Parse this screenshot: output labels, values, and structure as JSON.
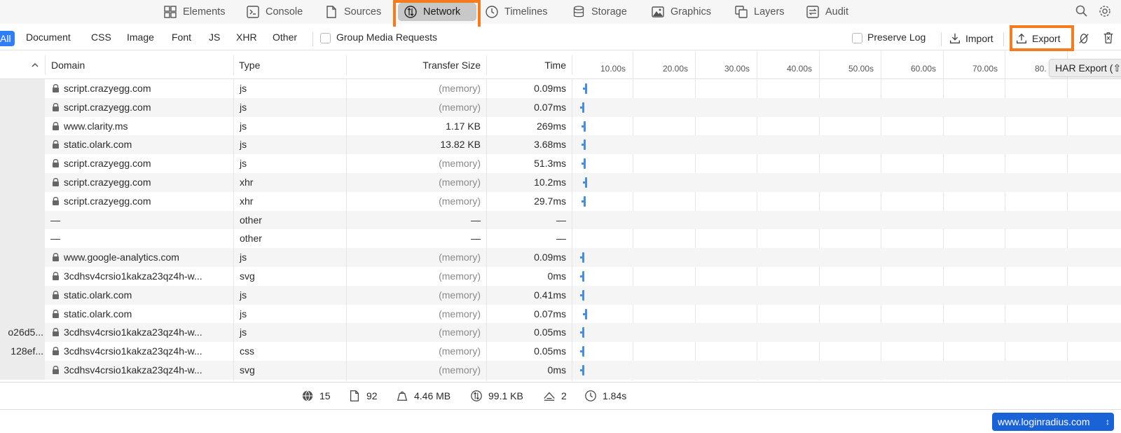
{
  "tabs": [
    {
      "label": "Elements",
      "icon": "elements-icon"
    },
    {
      "label": "Console",
      "icon": "console-icon"
    },
    {
      "label": "Sources",
      "icon": "sources-icon"
    },
    {
      "label": "Network",
      "icon": "network-icon",
      "active": true
    },
    {
      "label": "Timelines",
      "icon": "timelines-icon"
    },
    {
      "label": "Storage",
      "icon": "storage-icon"
    },
    {
      "label": "Graphics",
      "icon": "graphics-icon"
    },
    {
      "label": "Layers",
      "icon": "layers-icon"
    },
    {
      "label": "Audit",
      "icon": "audit-icon"
    }
  ],
  "filters": {
    "all": "All",
    "types": [
      "Document",
      "CSS",
      "Image",
      "Font",
      "JS",
      "XHR",
      "Other"
    ],
    "group_media": "Group Media Requests",
    "preserve_log": "Preserve Log",
    "import": "Import",
    "export": "Export",
    "tooltip": "HAR Export (⇧⌘E)"
  },
  "columns": {
    "domain": "Domain",
    "type": "Type",
    "transfer_size": "Transfer Size",
    "time": "Time"
  },
  "timeline_ticks": [
    "10.00s",
    "20.00s",
    "30.00s",
    "40.00s",
    "50.00s",
    "60.00s",
    "70.00s",
    "80."
  ],
  "rows": [
    {
      "name": "",
      "secure": true,
      "domain": "script.crazyegg.com",
      "type": "js",
      "size": "(memory)",
      "time": "0.09ms"
    },
    {
      "name": "",
      "secure": true,
      "domain": "script.crazyegg.com",
      "type": "js",
      "size": "(memory)",
      "time": "0.07ms"
    },
    {
      "name": "",
      "secure": true,
      "domain": "www.clarity.ms",
      "type": "js",
      "size": "1.17 KB",
      "time": "269ms"
    },
    {
      "name": "",
      "secure": true,
      "domain": "static.olark.com",
      "type": "js",
      "size": "13.82 KB",
      "time": "3.68ms"
    },
    {
      "name": "",
      "secure": true,
      "domain": "script.crazyegg.com",
      "type": "js",
      "size": "(memory)",
      "time": "51.3ms"
    },
    {
      "name": "",
      "secure": true,
      "domain": "script.crazyegg.com",
      "type": "xhr",
      "size": "(memory)",
      "time": "10.2ms"
    },
    {
      "name": "",
      "secure": true,
      "domain": "script.crazyegg.com",
      "type": "xhr",
      "size": "(memory)",
      "time": "29.7ms"
    },
    {
      "name": "",
      "secure": false,
      "domain": "—",
      "type": "other",
      "size": "—",
      "time": "—"
    },
    {
      "name": "",
      "secure": false,
      "domain": "—",
      "type": "other",
      "size": "—",
      "time": "—"
    },
    {
      "name": "",
      "secure": true,
      "domain": "www.google-analytics.com",
      "type": "js",
      "size": "(memory)",
      "time": "0.09ms"
    },
    {
      "name": "",
      "secure": true,
      "domain": "3cdhsv4crsio1kakza23qz4h-w...",
      "type": "svg",
      "size": "(memory)",
      "time": "0ms"
    },
    {
      "name": "",
      "secure": true,
      "domain": "static.olark.com",
      "type": "js",
      "size": "(memory)",
      "time": "0.41ms"
    },
    {
      "name": "",
      "secure": true,
      "domain": "static.olark.com",
      "type": "js",
      "size": "(memory)",
      "time": "0.07ms"
    },
    {
      "name": "o26d5...",
      "secure": true,
      "domain": "3cdhsv4crsio1kakza23qz4h-w...",
      "type": "js",
      "size": "(memory)",
      "time": "0.05ms"
    },
    {
      "name": "128ef...",
      "secure": true,
      "domain": "3cdhsv4crsio1kakza23qz4h-w...",
      "type": "css",
      "size": "(memory)",
      "time": "0.05ms"
    },
    {
      "name": "",
      "secure": true,
      "domain": "3cdhsv4crsio1kakza23qz4h-w...",
      "type": "svg",
      "size": "(memory)",
      "time": "0ms"
    }
  ],
  "status": {
    "domains": "15",
    "resources": "92",
    "resources_size": "4.46 MB",
    "transferred": "99.1 KB",
    "redirects": "2",
    "load_time": "1.84s"
  },
  "target": "www.loginradius.com",
  "colors": {
    "accent": "#2f7ef6",
    "highlight": "#f47b20",
    "waterfall": "#4a8fd6"
  }
}
